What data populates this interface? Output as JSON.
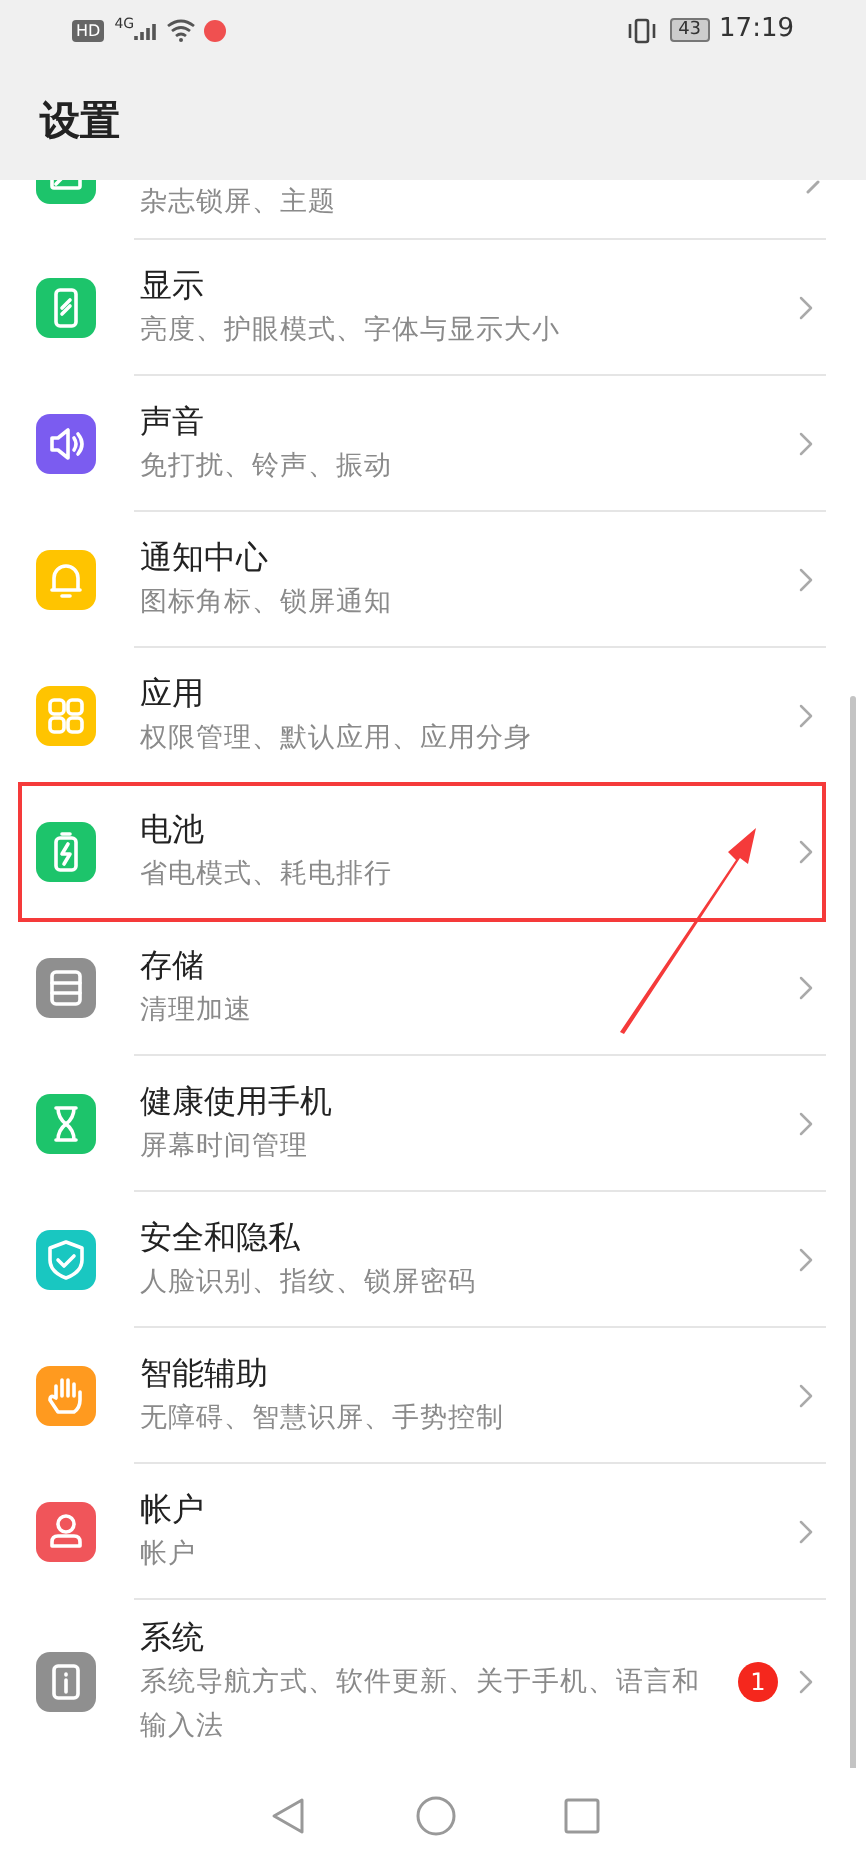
{
  "status_bar": {
    "left": "HD",
    "network": "4G",
    "battery": "43",
    "time": "17:19"
  },
  "header": {
    "title": "设置"
  },
  "items": [
    {
      "kind": "theme",
      "subtitle": "杂志锁屏、主题",
      "highlighted": false
    },
    {
      "kind": "display",
      "title": "显示",
      "subtitle": "亮度、护眼模式、字体与显示大小",
      "highlighted": false
    },
    {
      "kind": "sound",
      "title": "声音",
      "subtitle": "免打扰、铃声、振动",
      "highlighted": false
    },
    {
      "kind": "bell",
      "title": "通知中心",
      "subtitle": "图标角标、锁屏通知",
      "highlighted": false
    },
    {
      "kind": "apps",
      "title": "应用",
      "subtitle": "权限管理、默认应用、应用分身",
      "highlighted": false
    },
    {
      "kind": "battery",
      "title": "电池",
      "subtitle": "省电模式、耗电排行",
      "highlighted": true
    },
    {
      "kind": "storage",
      "title": "存储",
      "subtitle": "清理加速",
      "highlighted": false
    },
    {
      "kind": "hourglass",
      "title": "健康使用手机",
      "subtitle": "屏幕时间管理",
      "highlighted": false
    },
    {
      "kind": "shield",
      "title": "安全和隐私",
      "subtitle": "人脸识别、指纹、锁屏密码",
      "highlighted": false
    },
    {
      "kind": "hand",
      "title": "智能辅助",
      "subtitle": "无障碍、智慧识屏、手势控制",
      "highlighted": false
    },
    {
      "kind": "person",
      "title": "帐户",
      "subtitle": "帐户",
      "highlighted": false
    },
    {
      "kind": "info",
      "title": "系统",
      "subtitle": "系统导航方式、软件更新、关于手机、语言和输入法",
      "badge": "1",
      "highlighted": false
    }
  ]
}
